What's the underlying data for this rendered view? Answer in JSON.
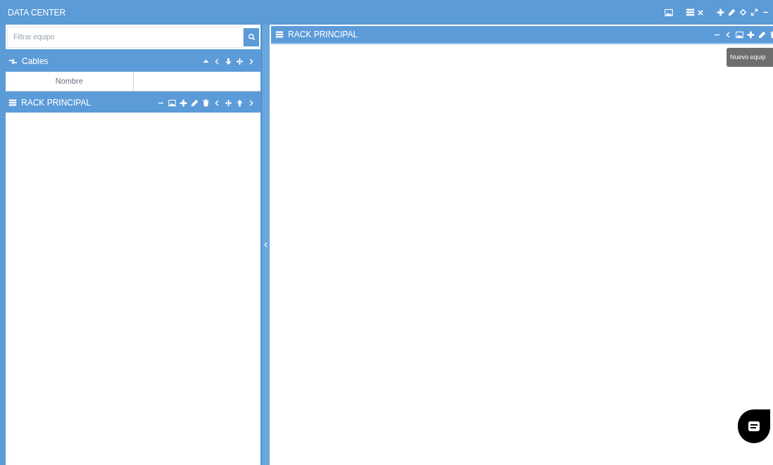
{
  "app_bar": {
    "title": "DATA CENTER"
  },
  "search": {
    "placeholder": "Filtrar equipo"
  },
  "cables_panel": {
    "title": "Cables",
    "columns": [
      "Nombre"
    ]
  },
  "rack_panel_left": {
    "title": "RACK PRINCIPAL"
  },
  "rack_panel_main": {
    "title": "RACK PRINCIPAL"
  },
  "tooltip": {
    "text": "Nuevo equip"
  }
}
